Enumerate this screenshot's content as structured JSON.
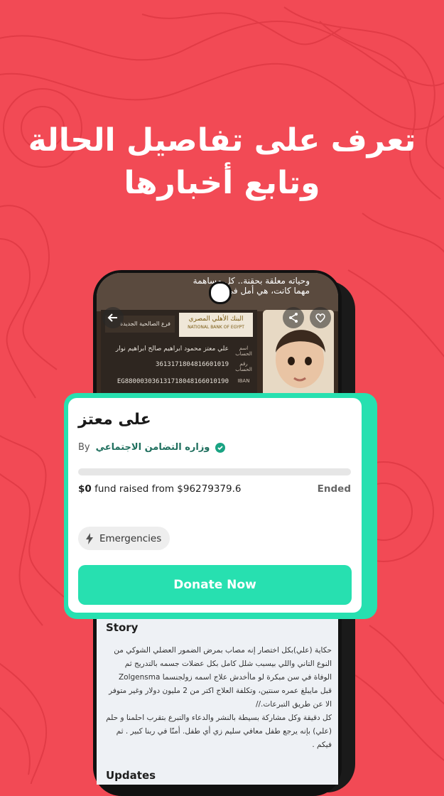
{
  "promo": {
    "headline_line1": "تعرف على تفاصيل الحالة",
    "headline_line2": "وتابع أخبارها"
  },
  "colors": {
    "background": "#f24a55",
    "accent": "#27e0b0",
    "org_text": "#1f6f5e"
  },
  "hero": {
    "caption_line1": "وحياته معلقة بحقنة.. كل مساهمة",
    "caption_line2": "مهما كانت، هي أمل في إنقاذ",
    "bank": {
      "logo_ar": "البنك الأهلي المصري",
      "logo_en": "NATIONAL BANK OF EGYPT",
      "branch": "فرع الصالحية الجديدة",
      "rows": [
        {
          "label": "اسم الحساب",
          "value": "علي معتز محمود ابراهيم صالح ابراهيم نوار"
        },
        {
          "label": "رقم الحساب",
          "value": "3613171804816601019"
        },
        {
          "label": "IBAN",
          "value": "EG880003036131718048166010190"
        }
      ]
    },
    "icons": {
      "back": "arrow-left-icon",
      "share": "share-icon",
      "favorite": "heart-icon"
    }
  },
  "campaign": {
    "name": "على معتز",
    "by_label": "By",
    "organization": "وزاره التضامن الاجتماعي",
    "progress": 0.0,
    "fund_amount": "$0",
    "fund_text": " fund raised from $96279379.6",
    "status": "Ended",
    "category": "Emergencies",
    "donate_label": "Donate Now"
  },
  "story": {
    "title": "Story",
    "paragraphs": [
      "حكاية (علي)بكل اختصار إنه مصاب بمرض الضمور العضلي الشوكي من النوع التاني واللي بيسبب شلل كامل بكل عضلات جسمه بالتدريج ثم الوفاة في سن مبكرة لو ماأخدش علاج اسمه زولجنسما Zolgensma قبل مايبلغ عمره سنتين، وتكلفة العلاج اكتر من 2 مليون دولار وغير متوفر الا عن طريق التبرعات.//",
      "كل دقيقة وكل مشاركة بسيطة بالنشر والدعاء والتبرع بتقرب احلمنا و حلم (علي) بإنه يرجع طفل معافي سليم زي أي طفل. أمنّا في ربنا كبير . ثم فيكم ."
    ],
    "updates_title": "Updates"
  }
}
